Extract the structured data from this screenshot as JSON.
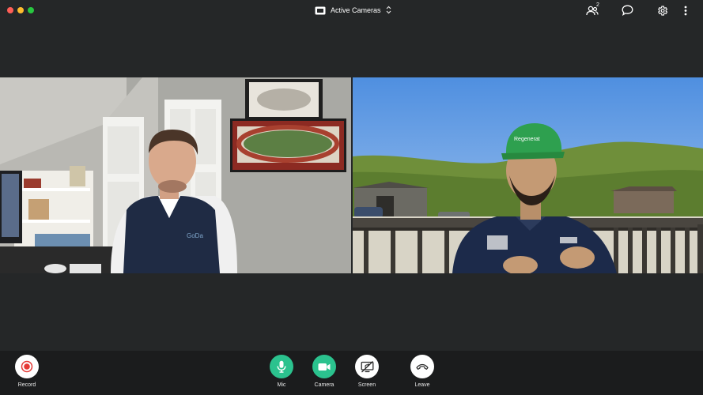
{
  "window": {
    "view_selector_label": "Active Cameras"
  },
  "header": {
    "participants_count": "2"
  },
  "icons": {
    "camera_view": "camera-view-icon",
    "participants": "participants-icon",
    "chat": "chat-icon",
    "settings": "gear-icon",
    "more": "more-vertical-icon"
  },
  "toolbar": {
    "record_label": "Record",
    "mic_label": "Mic",
    "camera_label": "Camera",
    "screen_label": "Screen",
    "leave_label": "Leave"
  },
  "colors": {
    "background": "#252728",
    "toolbar": "#1b1c1d",
    "accent_green": "#2bc28e",
    "record_red": "#e53935"
  }
}
